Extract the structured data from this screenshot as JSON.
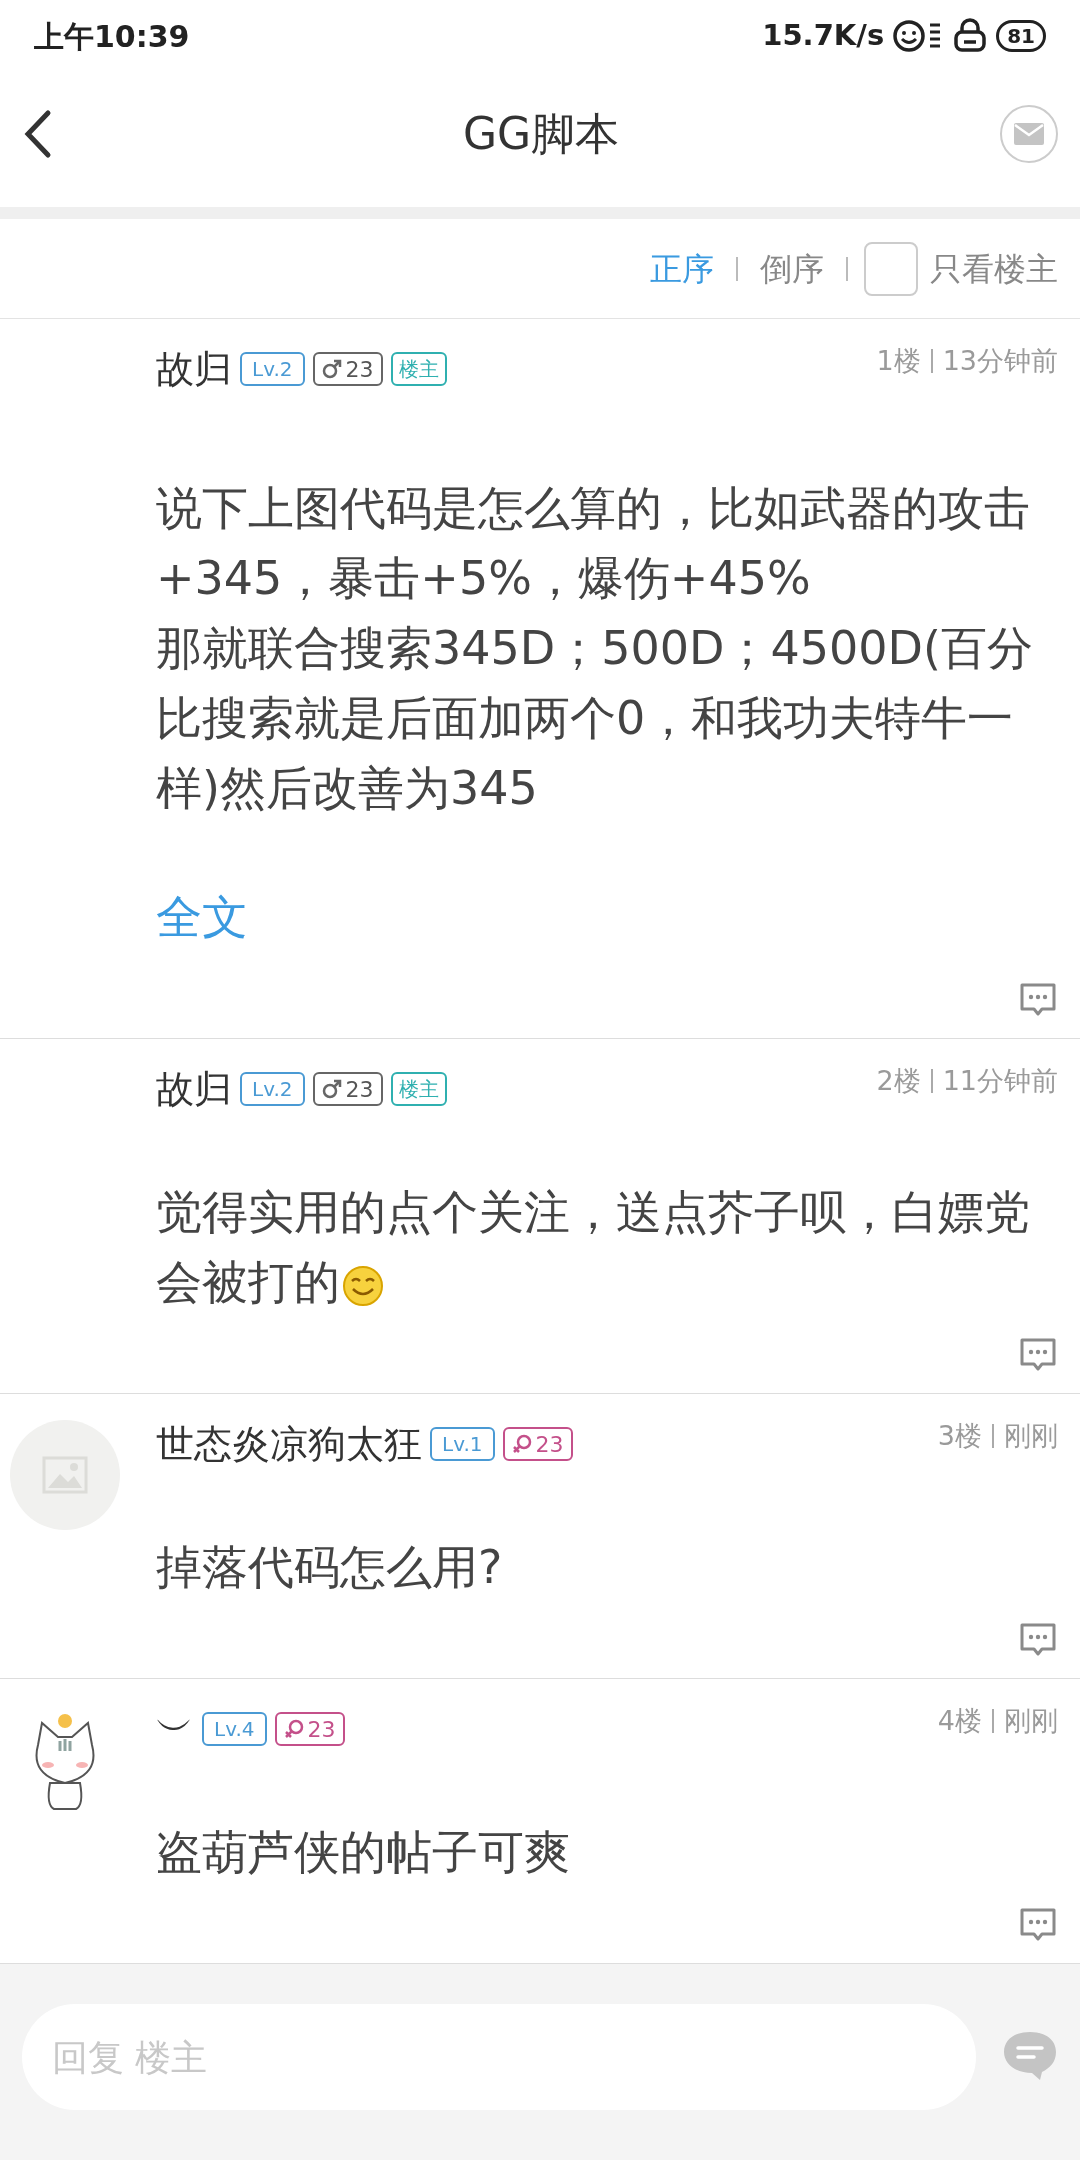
{
  "status_bar": {
    "time": "上午10:39",
    "speed": "15.7K/s",
    "battery": "81"
  },
  "header": {
    "title": "GG脚本"
  },
  "sort": {
    "options": [
      {
        "label": "正序",
        "selected": true
      },
      {
        "label": "倒序",
        "selected": false
      }
    ],
    "op_only": {
      "label": "只看楼主",
      "checked": false
    }
  },
  "posts": [
    {
      "author": "故归",
      "level": "Lv.2",
      "gender": {
        "kind": "male",
        "age": "23"
      },
      "op_badge": "楼主",
      "floor": "1楼",
      "time": "13分钟前",
      "text": [
        "说下上图代码是怎么算的，比如武器的攻击+345，暴击+5%，爆伤+45%",
        "那就联合搜索345D；500D；4500D(百分比搜索就是后面加两个0，和我功夫特牛一样)然后改善为345"
      ],
      "more": "全文"
    },
    {
      "author": "故归",
      "level": "Lv.2",
      "gender": {
        "kind": "male",
        "age": "23"
      },
      "op_badge": "楼主",
      "floor": "2楼",
      "time": "11分钟前",
      "text": [
        "觉得实用的点个关注，送点芥子呗，白嫖党会被打的"
      ],
      "emoji": true
    },
    {
      "avatar": {
        "kind": "placeholder"
      },
      "author": "世态炎凉狗太狂",
      "level": "Lv.1",
      "gender": {
        "kind": "female",
        "age": "23"
      },
      "floor": "3楼",
      "time": "刚刚",
      "text": [
        "掉落代码怎么用?"
      ]
    },
    {
      "avatar": {
        "kind": "cat"
      },
      "author": "︶",
      "level": "Lv.4",
      "gender": {
        "kind": "female",
        "age": "23"
      },
      "floor": "4楼",
      "time": "刚刚",
      "text": [
        "盗葫芦侠的帖子可爽"
      ]
    }
  ],
  "reply": {
    "placeholder": "回复 楼主"
  }
}
